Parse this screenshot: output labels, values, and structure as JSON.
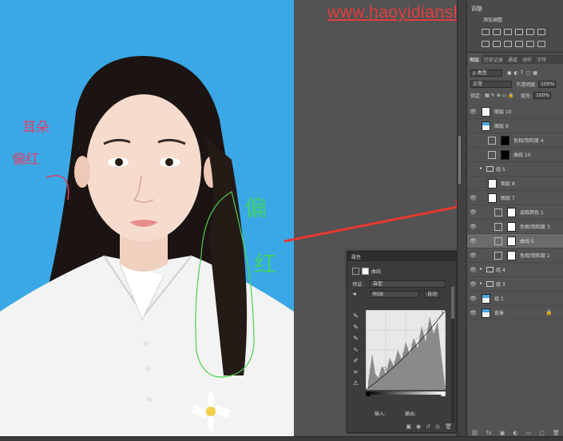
{
  "watermark": "www.haoyidianshe.com",
  "annotations": {
    "ear_note": "耳朵\n偏红",
    "hair_note": "偏红"
  },
  "colors": {
    "photo_background": "#3aa8e6",
    "arrow": "#e7392f",
    "selection_outline": "#4dd04d",
    "panel": "#535353"
  },
  "properties": {
    "title": "属性",
    "type_label": "曲线",
    "preset_label": "预设:",
    "preset_value": "自定",
    "channel_value": "RGB",
    "auto_button": "自动",
    "input_label": "输入:",
    "output_label": "输出:",
    "footer_icons": [
      "clip-icon",
      "eye-prev-icon",
      "reset-icon",
      "visibility-icon",
      "trash-icon"
    ]
  },
  "adjustments": {
    "title": "调整",
    "hint": "添加调整"
  },
  "layers_panel": {
    "tabs": [
      "图层",
      "历史记录",
      "通道",
      "动作",
      "字符"
    ],
    "kind_filter": "ρ 类型",
    "blend_mode": "正常",
    "opacity_label": "不透明度:",
    "opacity_value": "100%",
    "lock_label": "锁定:",
    "fill_label": "填充:",
    "fill_value": "100%",
    "layers": [
      {
        "name": "图层 10",
        "type": "pixel",
        "visible": true,
        "indent": 0,
        "selected": false
      },
      {
        "name": "图层 9",
        "type": "photo",
        "visible": false,
        "indent": 0,
        "selected": false
      },
      {
        "name": "色相/饱和度 4",
        "type": "adjust",
        "visible": false,
        "indent": 0,
        "selected": false
      },
      {
        "name": "曲线 10",
        "type": "curves",
        "visible": false,
        "indent": 0,
        "selected": false
      },
      {
        "name": "组 5",
        "type": "group",
        "visible": false,
        "indent": 0,
        "selected": false
      },
      {
        "name": "图层 8",
        "type": "pixel",
        "visible": false,
        "indent": 1,
        "selected": false
      },
      {
        "name": "图层 7",
        "type": "pixel",
        "visible": true,
        "indent": 1,
        "selected": false
      },
      {
        "name": "选取颜色 1",
        "type": "adjust",
        "visible": true,
        "indent": 1,
        "selected": false
      },
      {
        "name": "色相/饱和度 3",
        "type": "adjust",
        "visible": true,
        "indent": 1,
        "selected": false
      },
      {
        "name": "曲线 5",
        "type": "curves",
        "visible": true,
        "indent": 1,
        "selected": true
      },
      {
        "name": "色相/饱和度 2",
        "type": "adjust",
        "visible": true,
        "indent": 1,
        "selected": false
      },
      {
        "name": "组 4",
        "type": "group",
        "visible": true,
        "indent": 0,
        "selected": false
      },
      {
        "name": "组 3",
        "type": "group",
        "visible": true,
        "indent": 0,
        "selected": false
      },
      {
        "name": "组 1",
        "type": "photo",
        "visible": true,
        "indent": 0,
        "selected": false
      },
      {
        "name": "背景",
        "type": "photo",
        "visible": true,
        "indent": 0,
        "selected": false,
        "locked": true
      }
    ]
  }
}
